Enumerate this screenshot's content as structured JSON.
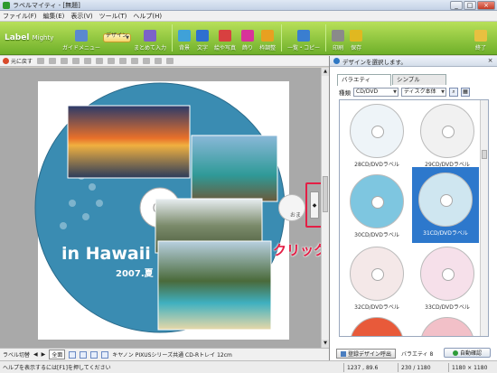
{
  "window": {
    "title": "ラベルマイティ - [無題]",
    "minimize": "_",
    "maximize": "□",
    "close": "×"
  },
  "menu": [
    "ファイル(F)",
    "編集(E)",
    "表示(V)",
    "ツール(T)",
    "ヘルプ(H)"
  ],
  "toolbar": {
    "logo": "Label",
    "logo_sub": "Mighty",
    "buttons": [
      {
        "label": "ガイドメニュー",
        "icon": "guide-menu-icon",
        "color": "#5a88d0"
      },
      {
        "label": "デザイン",
        "icon": "design-icon",
        "color": "#e48f2f",
        "selected": true
      },
      {
        "label": "まとめて入力",
        "icon": "batch-input-icon",
        "color": "#7b63c8"
      },
      {
        "label": "背景",
        "icon": "background-icon",
        "color": "#3fa1d8"
      },
      {
        "label": "文字",
        "icon": "text-icon",
        "color": "#2f6fd0"
      },
      {
        "label": "絵や写真",
        "icon": "picture-icon",
        "color": "#d84040"
      },
      {
        "label": "飾り",
        "icon": "decoration-icon",
        "color": "#d8329a"
      },
      {
        "label": "枠調整",
        "icon": "frame-adjust-icon",
        "color": "#e8a020"
      },
      {
        "label": "一覧・コピー",
        "icon": "list-copy-icon",
        "color": "#3a7ed0"
      },
      {
        "label": "印刷",
        "icon": "print-icon",
        "color": "#8a8a8a"
      },
      {
        "label": "保存",
        "icon": "save-icon",
        "color": "#e0b820"
      }
    ],
    "end_label": "終了"
  },
  "editor_toolbar": {
    "undo_label": "元に戻す"
  },
  "canvas": {
    "cd_title": "in Hawaii",
    "cd_subtitle": "2007.夏",
    "cd_color": "#3a8cb2",
    "spinner_label": "おま"
  },
  "annotation": {
    "click_text": "クリック",
    "color": "#e41e45"
  },
  "bottom_bar": {
    "label_switch": "ラベル切替",
    "zoom_full": "全面",
    "media_name": "キヤノン PIXUSシリーズ共通 CD-Rトレイ 12cm"
  },
  "status_bar": {
    "help": "ヘルプを表示するには[F1]を押してください",
    "cursor": "1237 , 89.6",
    "page": "230 / 1180",
    "size": "1180 × 1180"
  },
  "panel": {
    "title": "デザインを選択します。",
    "tabs": [
      "バラエティ",
      "シンプル"
    ],
    "category_label": "種類",
    "category_value": "CD/DVD",
    "style_value": "ディスク本体",
    "items": [
      {
        "label": "28CD/DVDラベル",
        "bg": "#eef4f8"
      },
      {
        "label": "29CD/DVDラベル",
        "bg": "#f1f1f1"
      },
      {
        "label": "30CD/DVDラベル",
        "bg": "#7ec6e0"
      },
      {
        "label": "31CD/DVDラベル",
        "bg": "#cfe6f0",
        "selected": true
      },
      {
        "label": "32CD/DVDラベル",
        "bg": "#f4e8e8"
      },
      {
        "label": "33CD/DVDラベル",
        "bg": "#f6e0ea"
      },
      {
        "label": "",
        "bg": "#e85a3a"
      },
      {
        "label": "",
        "bg": "#f2c0c8"
      }
    ],
    "auto_button": "自動確認",
    "register_button": "登録デザイン呼出",
    "variety_count": "バラエティ 8"
  }
}
